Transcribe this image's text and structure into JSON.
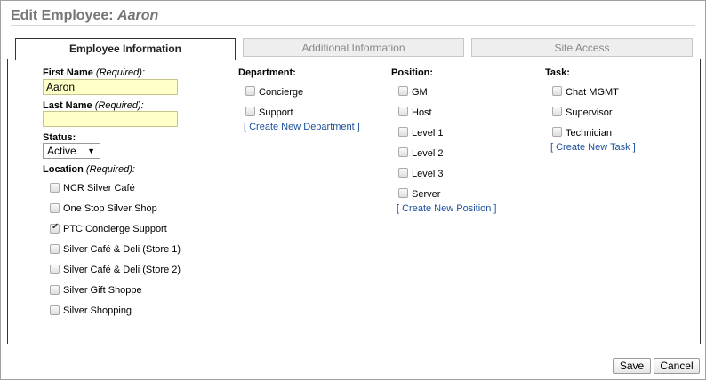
{
  "header": {
    "title_prefix": "Edit Employee:",
    "employee_name": "Aaron"
  },
  "tabs": [
    {
      "label": "Employee Information",
      "active": true
    },
    {
      "label": "Additional Information",
      "active": false
    },
    {
      "label": "Site Access",
      "active": false
    }
  ],
  "form": {
    "first_name": {
      "label": "First Name",
      "required": "(Required)",
      "suffix": ":",
      "value": "Aaron"
    },
    "last_name": {
      "label": "Last Name",
      "required": "(Required)",
      "suffix": ":",
      "value": ""
    },
    "status": {
      "label": "Status:",
      "value": "Active"
    },
    "location": {
      "label": "Location",
      "required": "(Required)",
      "suffix": ":",
      "items": [
        {
          "label": "NCR Silver Café",
          "checked": false
        },
        {
          "label": "One Stop Silver Shop",
          "checked": false
        },
        {
          "label": "PTC Concierge Support",
          "checked": true
        },
        {
          "label": "Silver Café & Deli (Store 1)",
          "checked": false
        },
        {
          "label": "Silver Café & Deli (Store 2)",
          "checked": false
        },
        {
          "label": "Silver Gift Shoppe",
          "checked": false
        },
        {
          "label": "Silver Shopping",
          "checked": false
        }
      ]
    }
  },
  "department": {
    "label": "Department:",
    "items": [
      {
        "label": "Concierge",
        "checked": false
      },
      {
        "label": "Support",
        "checked": false
      }
    ],
    "create_link": "[ Create New Department ]"
  },
  "position": {
    "label": "Position:",
    "items": [
      {
        "label": "GM",
        "checked": false
      },
      {
        "label": "Host",
        "checked": false
      },
      {
        "label": "Level 1",
        "checked": false
      },
      {
        "label": "Level 2",
        "checked": false
      },
      {
        "label": "Level 3",
        "checked": false
      },
      {
        "label": "Server",
        "checked": false
      }
    ],
    "create_link": "[ Create New Position ]"
  },
  "task": {
    "label": "Task:",
    "items": [
      {
        "label": "Chat MGMT",
        "checked": false
      },
      {
        "label": "Supervisor",
        "checked": false
      },
      {
        "label": "Technician",
        "checked": false
      }
    ],
    "create_link": "[ Create New Task ]"
  },
  "footer": {
    "save_label": "Save",
    "cancel_label": "Cancel"
  }
}
